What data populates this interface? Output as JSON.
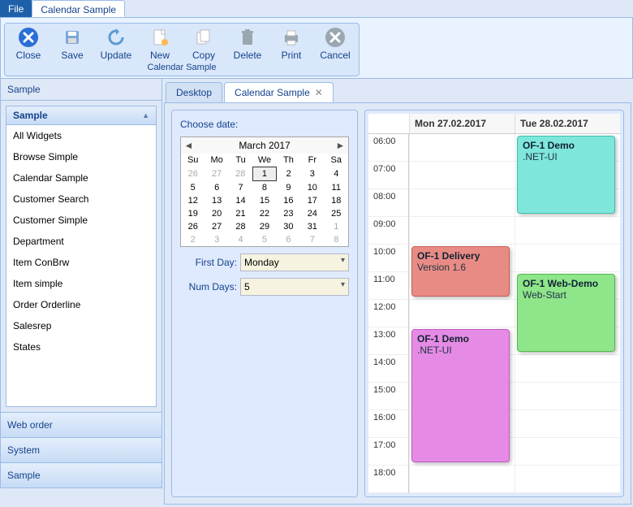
{
  "menu": {
    "file": "File",
    "tab": "Calendar Sample"
  },
  "ribbon": {
    "group_title": "Calendar Sample",
    "buttons": [
      {
        "name": "close",
        "label": "Close"
      },
      {
        "name": "save",
        "label": "Save"
      },
      {
        "name": "update",
        "label": "Update"
      },
      {
        "name": "new",
        "label": "New"
      },
      {
        "name": "copy",
        "label": "Copy"
      },
      {
        "name": "delete",
        "label": "Delete"
      },
      {
        "name": "print",
        "label": "Print"
      },
      {
        "name": "cancel",
        "label": "Cancel"
      }
    ]
  },
  "sidebar": {
    "title": "Sample",
    "panel_title": "Sample",
    "items": [
      "All Widgets",
      "Browse Simple",
      "Calendar Sample",
      "Customer Search",
      "Customer Simple",
      "Department",
      "Item ConBrw",
      "Item simple",
      "Order Orderline",
      "Salesrep",
      "States"
    ],
    "links": [
      "Web order",
      "System",
      "Sample"
    ]
  },
  "tabs": [
    {
      "label": "Desktop",
      "closable": false,
      "active": false
    },
    {
      "label": "Calendar Sample",
      "closable": true,
      "active": true
    }
  ],
  "date_panel": {
    "choose_label": "Choose date:",
    "month_title": "March 2017",
    "dow": [
      "Su",
      "Mo",
      "Tu",
      "We",
      "Th",
      "Fr",
      "Sa"
    ],
    "weeks": [
      [
        {
          "d": 26,
          "o": 1
        },
        {
          "d": 27,
          "o": 1
        },
        {
          "d": 28,
          "o": 1
        },
        {
          "d": 1,
          "sel": 1
        },
        {
          "d": 2
        },
        {
          "d": 3
        },
        {
          "d": 4
        }
      ],
      [
        {
          "d": 5
        },
        {
          "d": 6
        },
        {
          "d": 7
        },
        {
          "d": 8
        },
        {
          "d": 9
        },
        {
          "d": 10
        },
        {
          "d": 11
        }
      ],
      [
        {
          "d": 12
        },
        {
          "d": 13
        },
        {
          "d": 14
        },
        {
          "d": 15
        },
        {
          "d": 16
        },
        {
          "d": 17
        },
        {
          "d": 18
        }
      ],
      [
        {
          "d": 19
        },
        {
          "d": 20
        },
        {
          "d": 21
        },
        {
          "d": 22
        },
        {
          "d": 23
        },
        {
          "d": 24
        },
        {
          "d": 25
        }
      ],
      [
        {
          "d": 26
        },
        {
          "d": 27
        },
        {
          "d": 28
        },
        {
          "d": 29
        },
        {
          "d": 30
        },
        {
          "d": 31
        },
        {
          "d": 1,
          "o": 1
        }
      ],
      [
        {
          "d": 2,
          "o": 1
        },
        {
          "d": 3,
          "o": 1
        },
        {
          "d": 4,
          "o": 1
        },
        {
          "d": 5,
          "o": 1
        },
        {
          "d": 6,
          "o": 1
        },
        {
          "d": 7,
          "o": 1
        },
        {
          "d": 8,
          "o": 1
        }
      ]
    ],
    "first_day_label": "First Day:",
    "first_day_value": "Monday",
    "num_days_label": "Num Days:",
    "num_days_value": "5"
  },
  "calendar": {
    "days": [
      "Mon 27.02.2017",
      "Tue 28.02.2017"
    ],
    "hours": [
      "06:00",
      "07:00",
      "08:00",
      "09:00",
      "10:00",
      "11:00",
      "12:00",
      "13:00",
      "14:00",
      "15:00",
      "16:00",
      "17:00",
      "18:00"
    ],
    "events": [
      {
        "col": 0,
        "start": 4,
        "span": 2,
        "cls": "ev-red",
        "title": "OF-1 Delivery",
        "desc": "Version 1.6"
      },
      {
        "col": 0,
        "start": 7,
        "span": 5,
        "cls": "ev-pink",
        "title": "OF-1 Demo",
        "desc": ".NET-UI"
      },
      {
        "col": 1,
        "start": 0,
        "span": 3,
        "cls": "ev-teal",
        "title": "OF-1 Demo",
        "desc": ".NET-UI"
      },
      {
        "col": 1,
        "start": 5,
        "span": 3,
        "cls": "ev-green",
        "title": "OF-1 Web-Demo",
        "desc": "Web-Start"
      }
    ]
  }
}
